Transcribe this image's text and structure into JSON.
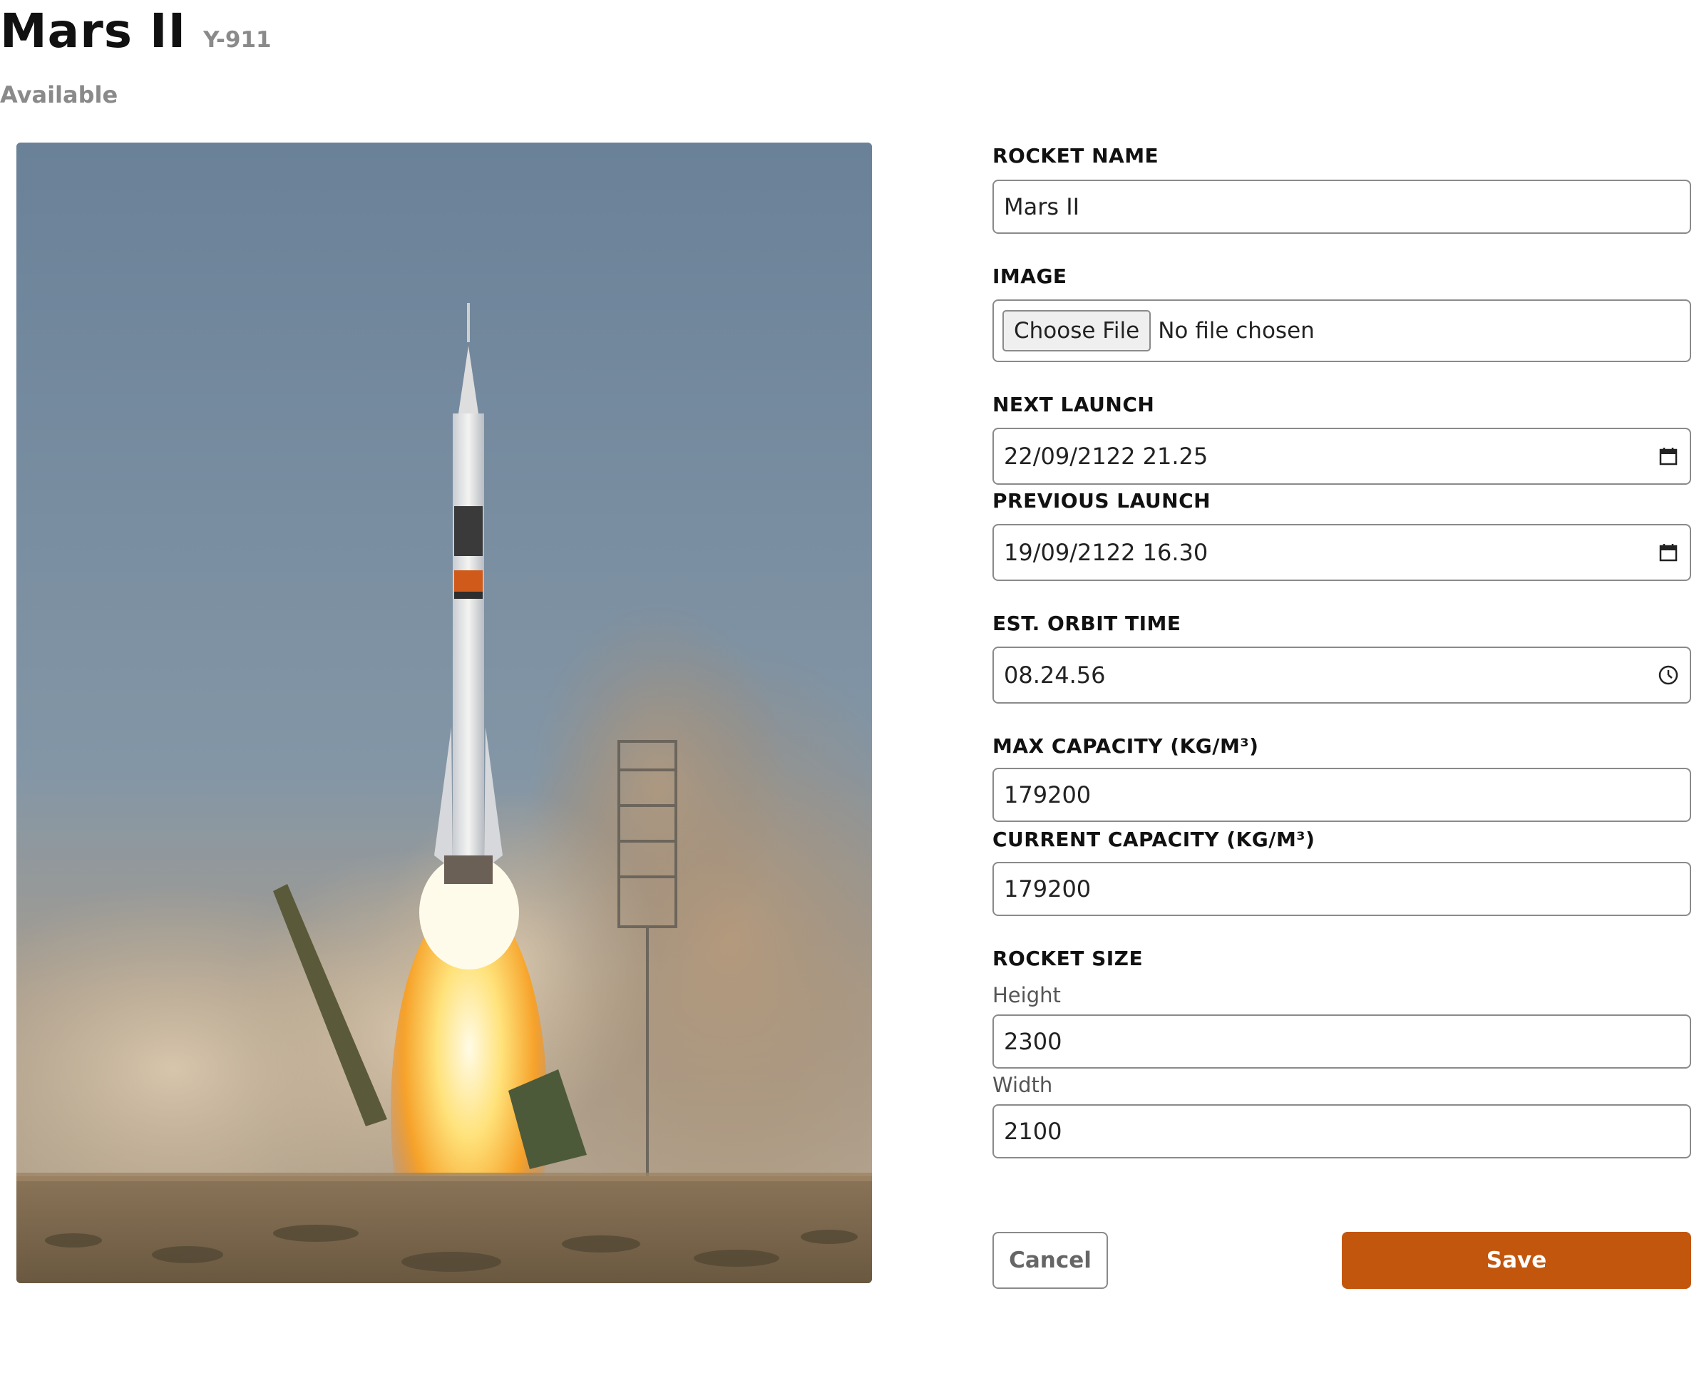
{
  "header": {
    "title": "Mars II",
    "serial": "Y-911",
    "status": "Available"
  },
  "photo": {
    "subject": "rocket-launch-image"
  },
  "form": {
    "rocket_name": {
      "label": "ROCKET NAME",
      "value": "Mars II"
    },
    "image": {
      "label": "IMAGE",
      "button": "Choose File",
      "status": "No file chosen"
    },
    "next_launch": {
      "label": "NEXT LAUNCH",
      "value": "22/09/2122  21.25",
      "icon": "calendar-icon"
    },
    "previous_launch": {
      "label": "PREVIOUS LAUNCH",
      "value": "19/09/2122  16.30",
      "icon": "calendar-icon"
    },
    "est_orbit_time": {
      "label": "EST. ORBIT TIME",
      "value": "08.24.56",
      "icon": "clock-icon"
    },
    "max_capacity": {
      "label": "MAX CAPACITY (KG/M³)",
      "value": "179200"
    },
    "current_capacity": {
      "label": "CURRENT CAPACITY (KG/M³)",
      "value": "179200"
    },
    "rocket_size": {
      "label": "ROCKET SIZE",
      "height_label": "Height",
      "height_value": "2300",
      "width_label": "Width",
      "width_value": "2100"
    }
  },
  "actions": {
    "cancel": "Cancel",
    "save": "Save"
  },
  "colors": {
    "accent": "#c2560d",
    "muted_text": "#8a8a8a",
    "border": "#8a8a8a"
  }
}
